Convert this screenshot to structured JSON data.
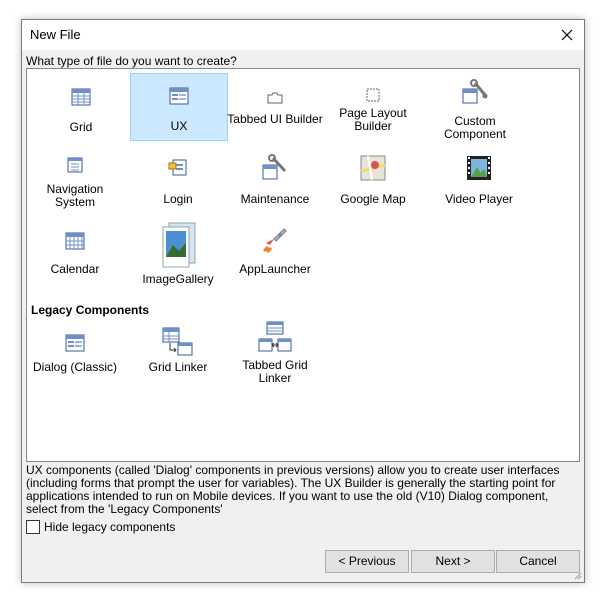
{
  "window": {
    "title": "New File"
  },
  "prompt": "What type of file do you want to create?",
  "tiles": [
    {
      "label": "Grid",
      "icon": "grid-icon"
    },
    {
      "label": "UX",
      "icon": "ux-icon",
      "selected": true
    },
    {
      "label": "Tabbed UI Builder",
      "icon": "tabbed-ui-builder-icon"
    },
    {
      "label": "Page Layout Builder",
      "icon": "page-layout-builder-icon"
    },
    {
      "label": "Custom Component",
      "icon": "custom-component-icon"
    },
    {
      "label": "Navigation System",
      "icon": "navigation-system-icon"
    },
    {
      "label": "Login",
      "icon": "login-icon"
    },
    {
      "label": "Maintenance",
      "icon": "maintenance-icon"
    },
    {
      "label": "Google Map",
      "icon": "google-map-icon"
    },
    {
      "label": "Video Player",
      "icon": "video-player-icon"
    },
    {
      "label": "Calendar",
      "icon": "calendar-icon"
    },
    {
      "label": "ImageGallery",
      "icon": "image-gallery-icon"
    },
    {
      "label": "AppLauncher",
      "icon": "app-launcher-icon"
    }
  ],
  "legacy": {
    "heading": "Legacy Components",
    "tiles": [
      {
        "label": "Dialog (Classic)",
        "icon": "dialog-classic-icon"
      },
      {
        "label": "Grid Linker",
        "icon": "grid-linker-icon"
      },
      {
        "label": "Tabbed Grid Linker",
        "icon": "tabbed-grid-linker-icon"
      }
    ]
  },
  "description": "UX components (called 'Dialog' components in previous versions) allow you to create user interfaces (including forms that prompt the user for variables). The UX Builder is generally the starting point for applications intended to run on Mobile devices.  If you want to use the old (V10) Dialog component, select from the 'Legacy Components'",
  "options": {
    "hide_legacy_label": "Hide legacy components",
    "hide_legacy_checked": false
  },
  "buttons": {
    "previous": "< Previous",
    "next": "Next >",
    "cancel": "Cancel"
  },
  "colors": {
    "selected_bg": "#cce8ff",
    "selected_border": "#99d1ff"
  }
}
